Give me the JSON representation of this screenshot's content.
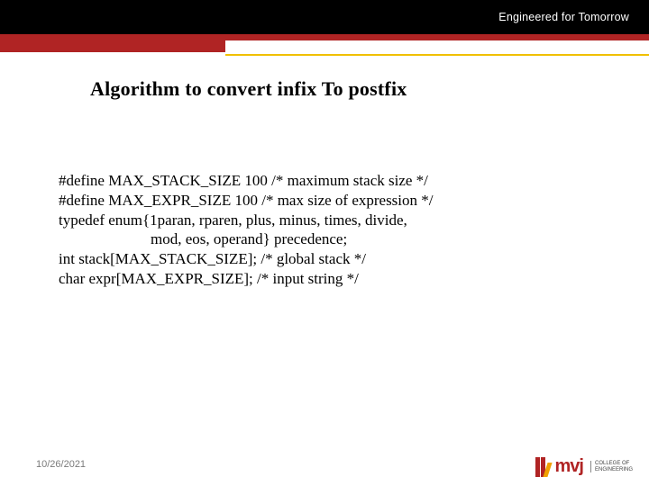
{
  "header": {
    "tagline": "Engineered for Tomorrow"
  },
  "slide": {
    "title": "Algorithm to convert infix  To postfix"
  },
  "code": {
    "l1": "#define MAX_STACK_SIZE 100 /* maximum stack size */",
    "l2": "#define MAX_EXPR_SIZE 100 /* max size of expression */",
    "l3": "typedef enum{1paran, rparen, plus, minus, times, divide,",
    "l4": "                        mod, eos, operand} precedence;",
    "l5": "int stack[MAX_STACK_SIZE]; /* global stack */",
    "l6": "char expr[MAX_EXPR_SIZE]; /* input string */"
  },
  "footer": {
    "date": "10/26/2021"
  },
  "logo": {
    "letters": "mvj",
    "sub1": "COLLEGE OF",
    "sub2": "ENGINEERING"
  }
}
